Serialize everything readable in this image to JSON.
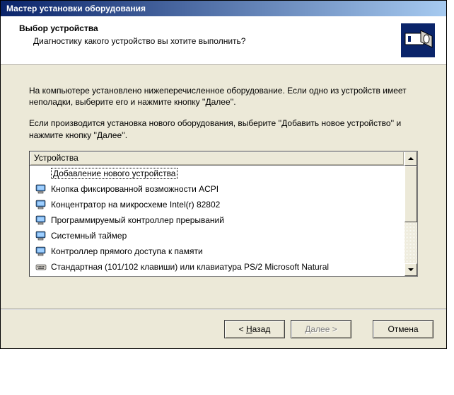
{
  "window": {
    "title": "Мастер установки оборудования"
  },
  "header": {
    "title": "Выбор устройства",
    "subtitle": "Диагностику какого устройство вы хотите выполнить?"
  },
  "content": {
    "para1": "На компьютере установлено нижеперечисленное оборудование. Если одно из устройств имеет неполадки, выберите его и нажмите кнопку ''Далее''.",
    "para2": "Если производится установка нового оборудования, выберите ''Добавить новое устройство'' и нажмите кнопку ''Далее''."
  },
  "listbox": {
    "header": "Устройства",
    "items": [
      {
        "label": "Добавление нового устройства",
        "icon": "blank"
      },
      {
        "label": "Кнопка фиксированной возможности ACPI",
        "icon": "monitor"
      },
      {
        "label": "Концентратор на микросхеме Intel(r) 82802",
        "icon": "monitor"
      },
      {
        "label": "Программируемый контроллер прерываний",
        "icon": "monitor"
      },
      {
        "label": "Системный таймер",
        "icon": "monitor"
      },
      {
        "label": "Контроллер прямого доступа к памяти",
        "icon": "monitor"
      },
      {
        "label": "Стандартная (101/102 клавиши) или клавиатура PS/2 Microsoft Natural",
        "icon": "keyboard"
      }
    ]
  },
  "buttons": {
    "back_prefix": "< ",
    "back_ul": "Н",
    "back_suffix": "азад",
    "next_ul": "Д",
    "next_suffix": "алее >",
    "cancel": "Отмена"
  }
}
